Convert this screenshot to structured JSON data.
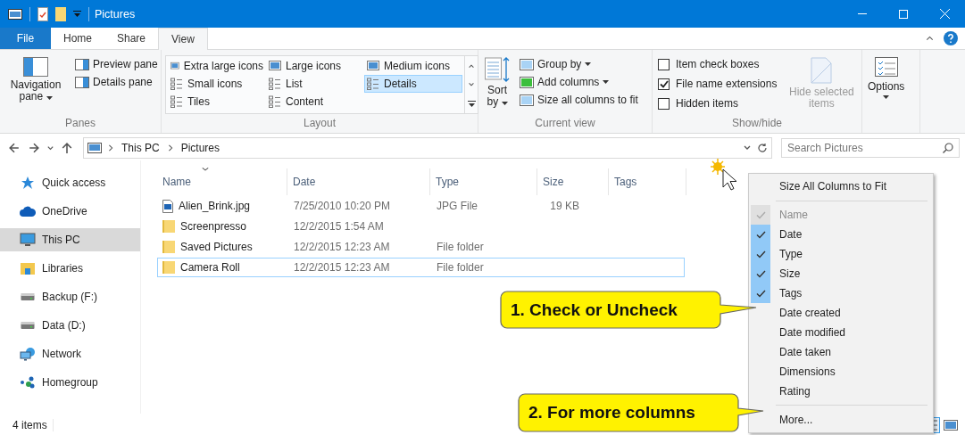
{
  "window": {
    "title": "Pictures"
  },
  "ribbon_tabs": [
    {
      "label": "File",
      "kind": "file",
      "selected": false
    },
    {
      "label": "Home",
      "kind": "tab",
      "selected": false
    },
    {
      "label": "Share",
      "kind": "tab",
      "selected": false
    },
    {
      "label": "View",
      "kind": "tab",
      "selected": true
    }
  ],
  "ribbon": {
    "panes": {
      "label": "Panes",
      "navigation_pane": "Navigation pane",
      "items": [
        "Preview pane",
        "Details pane"
      ]
    },
    "layout": {
      "label": "Layout",
      "options": [
        {
          "label": "Extra large icons",
          "selected": false
        },
        {
          "label": "Large icons",
          "selected": false
        },
        {
          "label": "Medium icons",
          "selected": false
        },
        {
          "label": "Small icons",
          "selected": false
        },
        {
          "label": "List",
          "selected": false
        },
        {
          "label": "Details",
          "selected": true
        },
        {
          "label": "Tiles",
          "selected": false
        },
        {
          "label": "Content",
          "selected": false
        }
      ]
    },
    "current_view": {
      "label": "Current view",
      "sort": "Sort by",
      "items": [
        {
          "label": "Group by",
          "dropdown": true
        },
        {
          "label": "Add columns",
          "dropdown": true
        },
        {
          "label": "Size all columns to fit",
          "dropdown": false
        }
      ]
    },
    "show_hide": {
      "label": "Show/hide",
      "checkboxes": [
        {
          "label": "Item check boxes",
          "checked": false
        },
        {
          "label": "File name extensions",
          "checked": true
        },
        {
          "label": "Hidden items",
          "checked": false
        }
      ],
      "hide_selected": {
        "label": "Hide selected items",
        "disabled": true
      }
    },
    "options": {
      "label": "Options"
    }
  },
  "address_bar": {
    "path": [
      "This PC",
      "Pictures"
    ]
  },
  "search": {
    "placeholder": "Search Pictures"
  },
  "navigation": [
    {
      "label": "Quick access",
      "kind": "star",
      "selected": false
    },
    {
      "label": "OneDrive",
      "kind": "cloud",
      "selected": false
    },
    {
      "label": "This PC",
      "kind": "pc",
      "selected": true
    },
    {
      "label": "Libraries",
      "kind": "library",
      "selected": false
    },
    {
      "label": "Backup (F:)",
      "kind": "drive",
      "selected": false
    },
    {
      "label": "Data (D:)",
      "kind": "drive",
      "selected": false
    },
    {
      "label": "Network",
      "kind": "network",
      "selected": false
    },
    {
      "label": "Homegroup",
      "kind": "homegroup",
      "selected": false
    }
  ],
  "table": {
    "columns": [
      "Name",
      "Date",
      "Type",
      "Size",
      "Tags"
    ],
    "rows": [
      {
        "name": "Alien_Brink.jpg",
        "date": "7/25/2010 10:20 PM",
        "type": "JPG File",
        "size": "19 KB",
        "kind": "image",
        "focused": false
      },
      {
        "name": "Screenpresso",
        "date": "12/2/2015 1:54 AM",
        "type": "",
        "size": "",
        "kind": "folder",
        "focused": false
      },
      {
        "name": "Saved Pictures",
        "date": "12/2/2015 12:23 AM",
        "type": "File folder",
        "size": "",
        "kind": "folder",
        "focused": false
      },
      {
        "name": "Camera Roll",
        "date": "12/2/2015 12:23 AM",
        "type": "File folder",
        "size": "",
        "kind": "folder",
        "focused": true
      }
    ]
  },
  "status_bar": {
    "count": "4 items",
    "views": [
      {
        "kind": "details",
        "selected": true
      },
      {
        "kind": "large",
        "selected": false
      }
    ]
  },
  "context_menu": {
    "items": [
      {
        "kind": "command",
        "label": "Size All Columns to Fit"
      },
      {
        "kind": "separator"
      },
      {
        "kind": "check",
        "label": "Name",
        "checked": true,
        "disabled": true
      },
      {
        "kind": "check",
        "label": "Date",
        "checked": true,
        "disabled": false
      },
      {
        "kind": "check",
        "label": "Type",
        "checked": true,
        "disabled": false
      },
      {
        "kind": "check",
        "label": "Size",
        "checked": true,
        "disabled": false
      },
      {
        "kind": "check",
        "label": "Tags",
        "checked": true,
        "disabled": false
      },
      {
        "kind": "check",
        "label": "Date created",
        "checked": false,
        "disabled": false
      },
      {
        "kind": "check",
        "label": "Date modified",
        "checked": false,
        "disabled": false
      },
      {
        "kind": "check",
        "label": "Date taken",
        "checked": false,
        "disabled": false
      },
      {
        "kind": "check",
        "label": "Dimensions",
        "checked": false,
        "disabled": false
      },
      {
        "kind": "check",
        "label": "Rating",
        "checked": false,
        "disabled": false
      },
      {
        "kind": "separator"
      },
      {
        "kind": "command",
        "label": "More..."
      }
    ]
  },
  "callouts": [
    {
      "text": "1. Check or Uncheck"
    },
    {
      "text": "2. For more columns"
    }
  ]
}
